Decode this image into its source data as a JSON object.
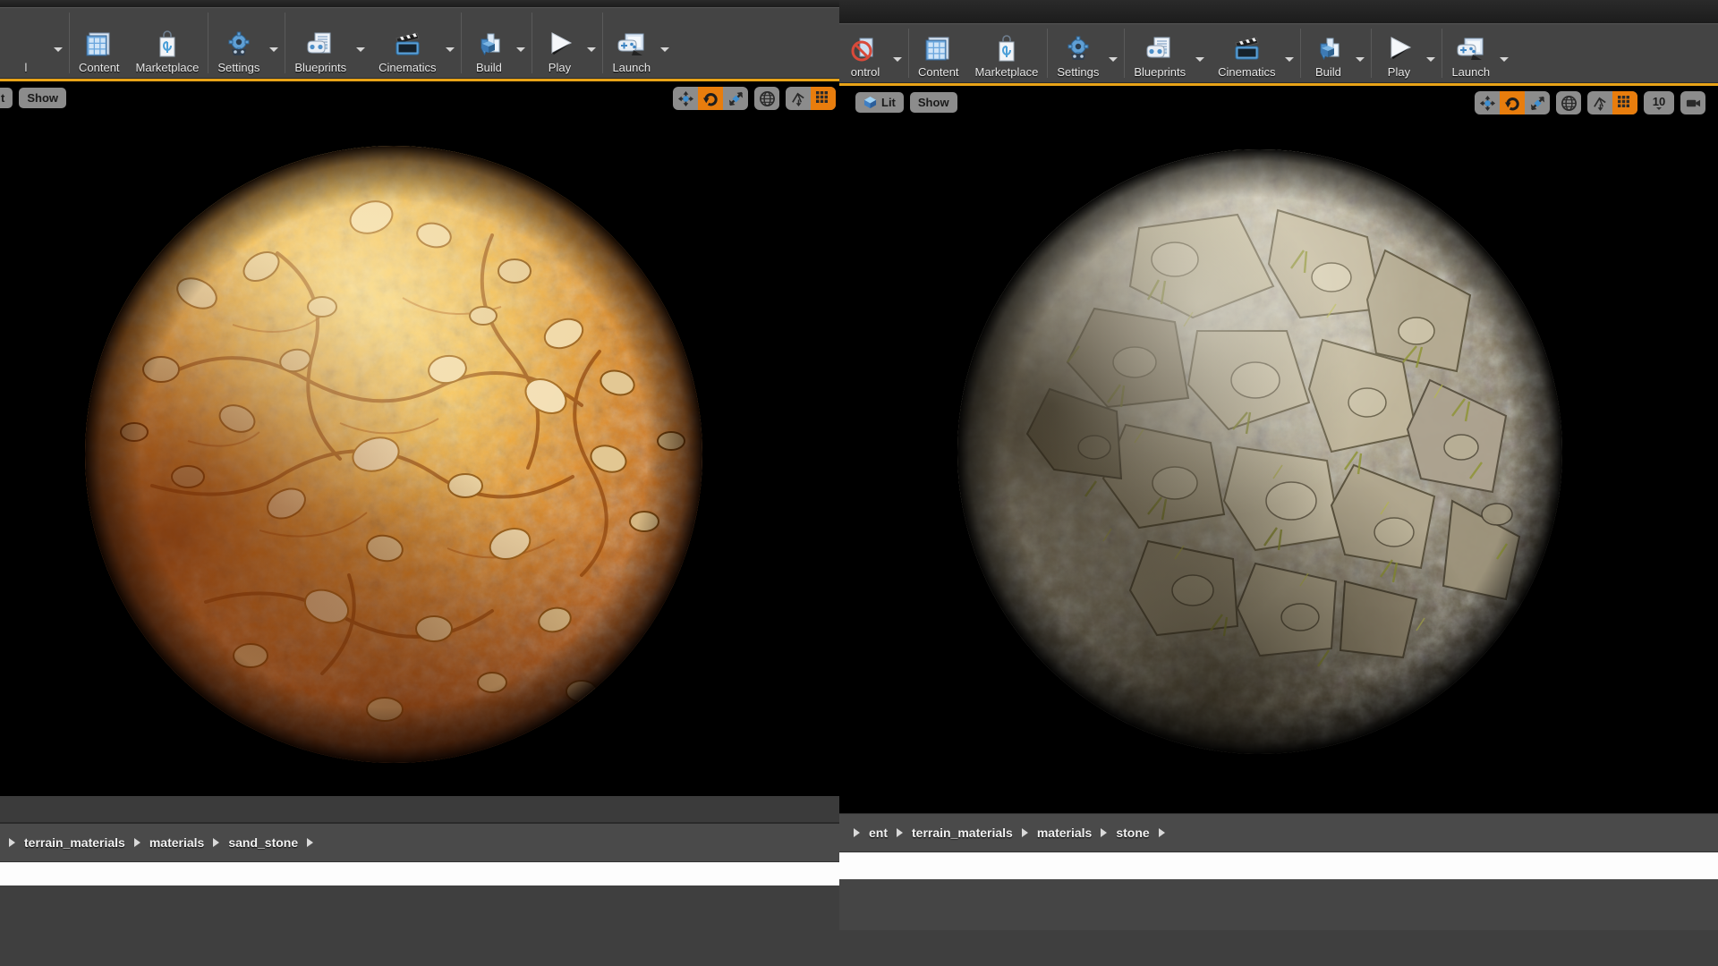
{
  "app": {
    "name": "Unreal Engine Material Editor",
    "accent_orange": "#e87d0d",
    "viewport_border": "#e8a317"
  },
  "left_window": {
    "toolbar": {
      "truncated_left_label": "l",
      "items": [
        {
          "label": "Content",
          "icon": "content-browser-icon",
          "has_caret": false
        },
        {
          "label": "Marketplace",
          "icon": "marketplace-bag-icon",
          "has_caret": false
        },
        {
          "label": "Settings",
          "icon": "settings-gear-icon",
          "has_caret": true
        },
        {
          "label": "Blueprints",
          "icon": "blueprints-icon",
          "has_caret": true
        },
        {
          "label": "Cinematics",
          "icon": "cinematics-clapper-icon",
          "has_caret": true
        },
        {
          "label": "Build",
          "icon": "build-icon",
          "has_caret": true
        },
        {
          "label": "Play",
          "icon": "play-triangle-icon",
          "has_caret": true
        },
        {
          "label": "Launch",
          "icon": "launch-gamepad-icon",
          "has_caret": true
        }
      ]
    },
    "viewport": {
      "lit_label": "t",
      "show_label": "Show",
      "gizmos": [
        {
          "name": "translate-gizmo",
          "active": false
        },
        {
          "name": "rotate-gizmo",
          "active": true
        },
        {
          "name": "scale-gizmo",
          "active": false
        }
      ],
      "coord_space": {
        "name": "world-space-toggle",
        "active": false
      },
      "surface_snap": {
        "name": "surface-snap-toggle",
        "active": false
      },
      "grid_snap": {
        "name": "grid-snap-toggle",
        "active": true
      },
      "preview": {
        "asset": "sand_stone",
        "description": "sand_stone material preview sphere",
        "palette": [
          "#f0a93a",
          "#e08a23",
          "#c96a1a",
          "#a54f12",
          "#6e2f08"
        ]
      }
    },
    "breadcrumb": [
      "terrain_materials",
      "materials",
      "sand_stone"
    ]
  },
  "right_window": {
    "toolbar": {
      "truncated_left_label": "ontrol",
      "truncated_left_icon": "source-control-icon",
      "items": [
        {
          "label": "Content",
          "icon": "content-browser-icon",
          "has_caret": false
        },
        {
          "label": "Marketplace",
          "icon": "marketplace-bag-icon",
          "has_caret": false
        },
        {
          "label": "Settings",
          "icon": "settings-gear-icon",
          "has_caret": true
        },
        {
          "label": "Blueprints",
          "icon": "blueprints-icon",
          "has_caret": true
        },
        {
          "label": "Cinematics",
          "icon": "cinematics-clapper-icon",
          "has_caret": true
        },
        {
          "label": "Build",
          "icon": "build-icon",
          "has_caret": true
        },
        {
          "label": "Play",
          "icon": "play-triangle-icon",
          "has_caret": true
        },
        {
          "label": "Launch",
          "icon": "launch-gamepad-icon",
          "has_caret": true
        }
      ]
    },
    "viewport": {
      "lit_label": "Lit",
      "show_label": "Show",
      "gizmos": [
        {
          "name": "translate-gizmo",
          "active": false
        },
        {
          "name": "rotate-gizmo",
          "active": true
        },
        {
          "name": "scale-gizmo",
          "active": false
        }
      ],
      "coord_space": {
        "name": "world-space-toggle",
        "active": false
      },
      "surface_snap": {
        "name": "surface-snap-toggle",
        "active": false
      },
      "grid_snap": {
        "name": "grid-snap-toggle",
        "active": true
      },
      "grid_snap_value": "10",
      "preview": {
        "asset": "stone",
        "description": "stone material preview sphere with grass and dirt",
        "palette": [
          "#cfc7ad",
          "#a79a81",
          "#7d725c",
          "#4d4536",
          "#2a2518"
        ]
      }
    },
    "breadcrumb": [
      "ent",
      "terrain_materials",
      "materials",
      "stone"
    ]
  }
}
